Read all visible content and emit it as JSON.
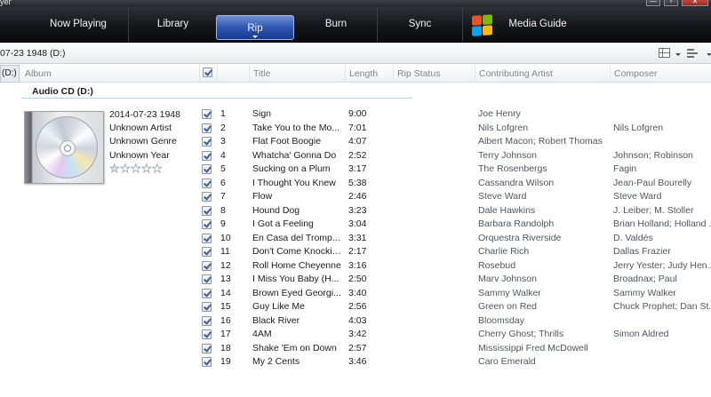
{
  "window": {
    "title_fragment": "yer",
    "minimize_glyph": "—",
    "restore_glyph": "▫",
    "close_glyph": "✕"
  },
  "nav": {
    "tabs": [
      {
        "label": "Now Playing"
      },
      {
        "label": "Library"
      },
      {
        "label": "Rip",
        "active": true
      },
      {
        "label": "Burn"
      },
      {
        "label": "Sync"
      },
      {
        "label": "Media Guide"
      }
    ],
    "logo_colors": [
      "#f25022",
      "#7fba00",
      "#00a4ef",
      "#ffb900"
    ]
  },
  "address": {
    "path": "07-23 1948 (D:)"
  },
  "nav_pane": {
    "label": "(D:)"
  },
  "columns": {
    "album": "Album",
    "title": "Title",
    "length": "Length",
    "rip_status": "Rip Status",
    "contributing_artist": "Contributing Artist",
    "composer": "Composer"
  },
  "group": {
    "label": "Audio CD (D:)"
  },
  "album": {
    "title": "2014-07-23 1948",
    "artist": "Unknown Artist",
    "genre": "Unknown Genre",
    "year": "Unknown Year",
    "rating": 0.5,
    "star_glyph": "★"
  },
  "tracks": [
    {
      "num": "1",
      "title": "Sign",
      "length": "9:00",
      "artist": "Joe Henry",
      "composer": ""
    },
    {
      "num": "2",
      "title": "Take You to the Mo...",
      "length": "7:01",
      "artist": "Nils Lofgren",
      "composer": "Nils Lofgren"
    },
    {
      "num": "3",
      "title": "Flat Foot Boogie",
      "length": "4:07",
      "artist": "Albert Macon;  Robert Thomas",
      "composer": ""
    },
    {
      "num": "4",
      "title": "Whatcha' Gonna Do",
      "length": "2:52",
      "artist": "Terry Johnson",
      "composer": "Johnson; Robinson"
    },
    {
      "num": "5",
      "title": "Sucking on a Plum",
      "length": "3:17",
      "artist": "The Rosenbergs",
      "composer": "Fagin"
    },
    {
      "num": "6",
      "title": "I Thought You Knew",
      "length": "5:38",
      "artist": "Cassandra Wilson",
      "composer": "Jean-Paul Bourelly"
    },
    {
      "num": "7",
      "title": "Flow",
      "length": "2:46",
      "artist": "Steve Ward",
      "composer": "Steve Ward"
    },
    {
      "num": "8",
      "title": "Hound Dog",
      "length": "3:23",
      "artist": "Dale Hawkins",
      "composer": "J. Leiber; M. Stoller"
    },
    {
      "num": "9",
      "title": "I Got a Feeling",
      "length": "3:04",
      "artist": "Barbara Randolph",
      "composer": "Brian Holland; Holland ..."
    },
    {
      "num": "10",
      "title": "En Casa del Tromp...",
      "length": "3:31",
      "artist": "Orquestra Riverside",
      "composer": "D. Valdés"
    },
    {
      "num": "11",
      "title": "Don't Come Knockin...",
      "length": "2:17",
      "artist": "Charlie Rich",
      "composer": "Dallas Frazier"
    },
    {
      "num": "12",
      "title": "Roll Home Cheyenne",
      "length": "3:16",
      "artist": "Rosebud",
      "composer": "Jerry Yester; Judy Hen..."
    },
    {
      "num": "13",
      "title": "I Miss You Baby (H...",
      "length": "2:50",
      "artist": "Marv Johnson",
      "composer": "Broadnax; Paul"
    },
    {
      "num": "14",
      "title": "Brown Eyed Georgi...",
      "length": "3:40",
      "artist": "Sammy Walker",
      "composer": "Sammy Walker"
    },
    {
      "num": "15",
      "title": "Guy Like Me",
      "length": "2:56",
      "artist": "Green on Red",
      "composer": "Chuck Prophet; Dan St..."
    },
    {
      "num": "16",
      "title": "Black River",
      "length": "4:03",
      "artist": "Bloomsday",
      "composer": ""
    },
    {
      "num": "17",
      "title": "4AM",
      "length": "3:42",
      "artist": "Cherry Ghost;  Thrills",
      "composer": "Simon Aldred"
    },
    {
      "num": "18",
      "title": "Shake 'Em on Down",
      "length": "2:57",
      "artist": "Mississippi Fred McDowell",
      "composer": ""
    },
    {
      "num": "19",
      "title": "My 2 Cents",
      "length": "3:46",
      "artist": "Caro Emerald",
      "composer": ""
    }
  ]
}
